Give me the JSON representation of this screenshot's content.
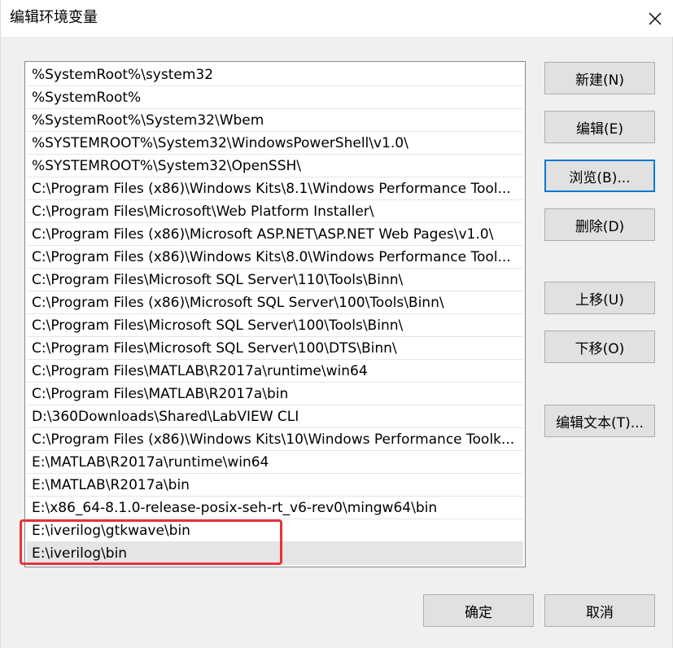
{
  "window": {
    "title": "编辑环境变量"
  },
  "path_entries": [
    "%SystemRoot%\\system32",
    "%SystemRoot%",
    "%SystemRoot%\\System32\\Wbem",
    "%SYSTEMROOT%\\System32\\WindowsPowerShell\\v1.0\\",
    "%SYSTEMROOT%\\System32\\OpenSSH\\",
    "C:\\Program Files (x86)\\Windows Kits\\8.1\\Windows Performance Tool...",
    "C:\\Program Files\\Microsoft\\Web Platform Installer\\",
    "C:\\Program Files (x86)\\Microsoft ASP.NET\\ASP.NET Web Pages\\v1.0\\",
    "C:\\Program Files (x86)\\Windows Kits\\8.0\\Windows Performance Tool...",
    "C:\\Program Files\\Microsoft SQL Server\\110\\Tools\\Binn\\",
    "C:\\Program Files (x86)\\Microsoft SQL Server\\100\\Tools\\Binn\\",
    "C:\\Program Files\\Microsoft SQL Server\\100\\Tools\\Binn\\",
    "C:\\Program Files\\Microsoft SQL Server\\100\\DTS\\Binn\\",
    "C:\\Program Files\\MATLAB\\R2017a\\runtime\\win64",
    "C:\\Program Files\\MATLAB\\R2017a\\bin",
    "D:\\360Downloads\\Shared\\LabVIEW CLI",
    "C:\\Program Files (x86)\\Windows Kits\\10\\Windows Performance Toolk...",
    "E:\\MATLAB\\R2017a\\runtime\\win64",
    "E:\\MATLAB\\R2017a\\bin",
    "E:\\x86_64-8.1.0-release-posix-seh-rt_v6-rev0\\mingw64\\bin",
    "E:\\iverilog\\gtkwave\\bin",
    "E:\\iverilog\\bin"
  ],
  "selected_index": 21,
  "buttons": {
    "new": "新建(N)",
    "edit": "编辑(E)",
    "browse": "浏览(B)...",
    "delete": "删除(D)",
    "move_up": "上移(U)",
    "move_down": "下移(O)",
    "edit_text": "编辑文本(T)...",
    "ok": "确定",
    "cancel": "取消"
  },
  "colors": {
    "highlight_box": "#e8323a",
    "focus_border": "#0078d7"
  }
}
